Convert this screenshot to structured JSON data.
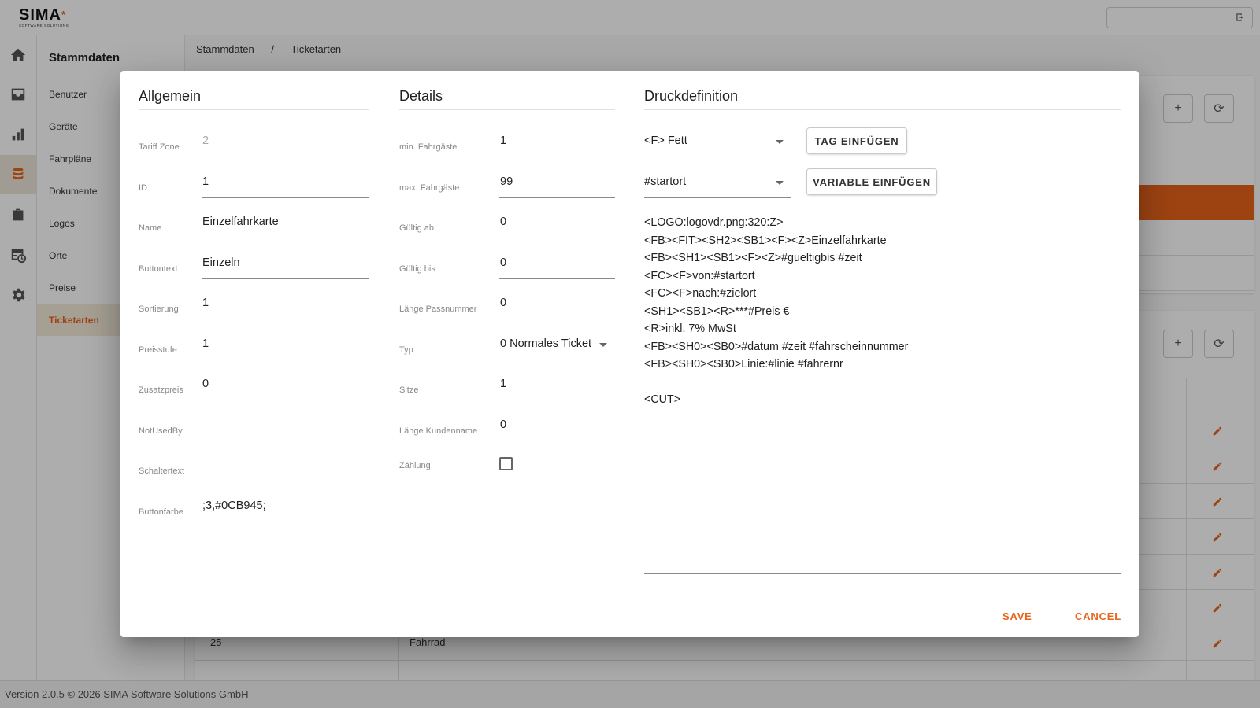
{
  "app": {
    "logo_text": "SIMA",
    "logo_subtitle": "SOFTWARE SOLUTIONS",
    "footer": "Version 2.0.5 © 2026 SIMA Software Solutions GmbH"
  },
  "rail": {
    "icons": [
      "home-icon",
      "inbox-icon",
      "bar-chart-icon",
      "database-icon",
      "briefcase-icon",
      "table-clock-icon",
      "gear-icon"
    ],
    "active": "database-icon"
  },
  "subnav": {
    "title": "Stammdaten",
    "items": [
      {
        "label": "Benutzer"
      },
      {
        "label": "Geräte"
      },
      {
        "label": "Fahrpläne"
      },
      {
        "label": "Dokumente"
      },
      {
        "label": "Logos"
      },
      {
        "label": "Orte"
      },
      {
        "label": "Preise"
      },
      {
        "label": "Ticketarten",
        "active": true
      }
    ]
  },
  "breadcrumb": {
    "root": "Stammdaten",
    "separator": "/",
    "current": "Ticketarten"
  },
  "background_table": {
    "visible_row": {
      "id": "25",
      "name": "Fahrrad"
    }
  },
  "dialog": {
    "allgemein": {
      "title": "Allgemein",
      "fields": [
        {
          "label": "Tariff Zone",
          "value": "2",
          "disabled": true
        },
        {
          "label": "ID",
          "value": "1"
        },
        {
          "label": "Name",
          "value": "Einzelfahrkarte"
        },
        {
          "label": "Buttontext",
          "value": "Einzeln"
        },
        {
          "label": "Sortierung",
          "value": "1"
        },
        {
          "label": "Preisstufe",
          "value": "1"
        },
        {
          "label": "Zusatzpreis",
          "value": "0"
        },
        {
          "label": "NotUsedBy",
          "value": ""
        },
        {
          "label": "Schaltertext",
          "value": ""
        },
        {
          "label": "Buttonfarbe",
          "value": ";3,#0CB945;"
        }
      ]
    },
    "details": {
      "title": "Details",
      "fields": [
        {
          "label": "min. Fahrgäste",
          "value": "1"
        },
        {
          "label": "max. Fahrgäste",
          "value": "99"
        },
        {
          "label": "Gültig ab",
          "value": "0"
        },
        {
          "label": "Gültig bis",
          "value": "0"
        },
        {
          "label": "Länge Passnummer",
          "value": "0"
        },
        {
          "label": "Typ",
          "value": "0 Normales Ticket",
          "select": true
        },
        {
          "label": "Sitze",
          "value": "1"
        },
        {
          "label": "Länge Kundenname",
          "value": "0"
        }
      ],
      "checkbox": {
        "label": "Zählung",
        "checked": false
      }
    },
    "druck": {
      "title": "Druckdefinition",
      "tag_select": "<F> Fett",
      "tag_button": "TAG EINFÜGEN",
      "variable_select": "#startort",
      "variable_button": "VARIABLE EINFÜGEN",
      "lines": [
        "<LOGO:logovdr.png:320:Z>",
        "<FB><FIT><SH2><SB1><F><Z>Einzelfahrkarte",
        "<FB><SH1><SB1><F><Z>#gueltigbis #zeit",
        "<FC><F>von:#startort",
        "<FC><F>nach:#zielort",
        "<SH1><SB1><R>***#Preis €",
        "<R>inkl. 7% MwSt",
        "<FB><SH0><SB0>#datum #zeit #fahrscheinnummer",
        "<FB><SH0><SB0>Linie:#linie #fahrernr",
        "",
        "<CUT>"
      ]
    },
    "actions": {
      "save": "SAVE",
      "cancel": "CANCEL"
    }
  },
  "colors": {
    "accent": "#e8641b",
    "active_bg": "#f3eadb"
  }
}
